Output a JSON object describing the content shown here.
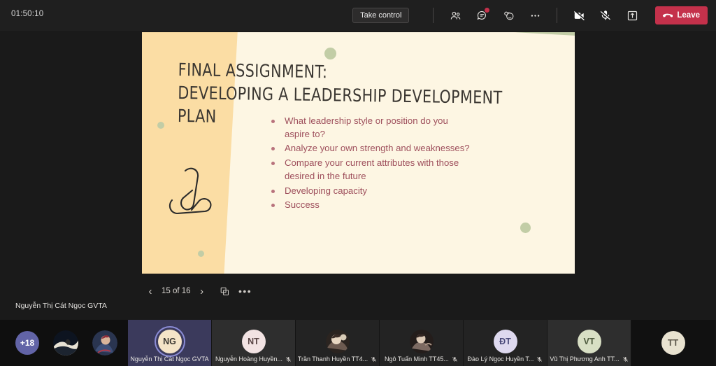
{
  "topbar": {
    "timer": "01:50:10",
    "take_control_label": "Take control",
    "leave_label": "Leave",
    "icons": [
      {
        "name": "people-icon",
        "label": "People"
      },
      {
        "name": "chat-icon",
        "label": "Chat",
        "badge": true
      },
      {
        "name": "reactions-icon",
        "label": "Reactions"
      },
      {
        "name": "more-options-icon",
        "label": "More options"
      },
      {
        "name": "camera-off-icon",
        "label": "Camera off"
      },
      {
        "name": "mic-off-icon",
        "label": "Mic off"
      },
      {
        "name": "share-icon",
        "label": "Share"
      }
    ],
    "accent_red": "#c4314b"
  },
  "slide": {
    "title": "FINAL ASSIGNMENT:\nDEVELOPING A LEADERSHIP DEVELOPMENT PLAN",
    "bullets": [
      "What leadership style or position do you aspire to?",
      "Analyze your own strength and weaknesses?",
      "Compare your current attributes with those desired in the future",
      "Developing capacity",
      "Success"
    ],
    "colors": {
      "background": "#fbdda4",
      "card": "#fdf6e3",
      "accent_green": "#c2cda6",
      "title_text": "#3a3631",
      "bullet_text": "#9e4f5c"
    },
    "decorations": [
      "paperclip-illustration",
      "sage-dot",
      "green-blob"
    ]
  },
  "slide_nav": {
    "prev_label": "‹",
    "next_label": "›",
    "page_indicator": "15 of 16",
    "thumbnails_label": "Thumbnails",
    "more_label": "•••"
  },
  "presenter": {
    "name": "Nguyễn Thị Cát Ngọc GVTA"
  },
  "filmstrip": {
    "overflow_badge": "+18",
    "avatars_photo_count": 2,
    "participants": [
      {
        "initials": "NG",
        "name": "Nguyễn Thị Cát Ngọc GVTA",
        "active": true,
        "muted": false,
        "avatar_bg": "#f5e4c8",
        "avatar_fg": "#3a3631",
        "photo": false
      },
      {
        "initials": "NT",
        "name": "Nguyễn Hoàng Huyền...",
        "active": false,
        "muted": true,
        "avatar_bg": "#f2e3e3",
        "avatar_fg": "#5a4646",
        "photo": false
      },
      {
        "initials": "",
        "name": "Trần Thanh Huyền TT4...",
        "active": false,
        "muted": true,
        "avatar_bg": "#8a7468",
        "avatar_fg": "#fff",
        "photo": true
      },
      {
        "initials": "",
        "name": "Ngô Tuấn Minh TT45...",
        "active": false,
        "muted": true,
        "avatar_bg": "#6e5b55",
        "avatar_fg": "#fff",
        "photo": true
      },
      {
        "initials": "ĐT",
        "name": "Đào Lý Ngọc Huyền T...",
        "active": false,
        "muted": true,
        "avatar_bg": "#ded9ef",
        "avatar_fg": "#4a4a7a",
        "photo": false
      },
      {
        "initials": "VT",
        "name": "Vũ Thị Phương Anh TT...",
        "active": false,
        "muted": true,
        "avatar_bg": "#d8dfc4",
        "avatar_fg": "#4d5a3d",
        "photo": false
      },
      {
        "initials": "TT",
        "name": "",
        "active": false,
        "muted": false,
        "avatar_bg": "#e8e2d0",
        "avatar_fg": "#5b564a",
        "photo": false
      }
    ]
  }
}
